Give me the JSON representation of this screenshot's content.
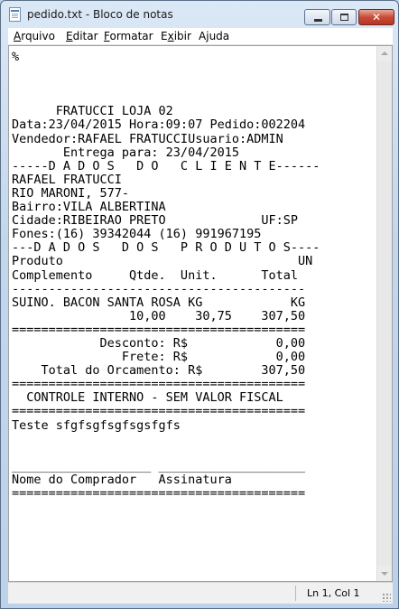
{
  "window": {
    "title": "pedido.txt - Bloco de notas"
  },
  "menu": {
    "items": [
      {
        "label": "Arquivo",
        "mnemonic": "A",
        "rest": "rquivo"
      },
      {
        "label": "Editar",
        "mnemonic": "E",
        "rest": "ditar"
      },
      {
        "label": "Formatar",
        "mnemonic": "F",
        "rest": "ormatar"
      },
      {
        "label": "Exibir",
        "mnemonic": "x",
        "pre": "E",
        "rest": "ibir"
      },
      {
        "label": "Ajuda",
        "mnemonic": "j",
        "pre": "A",
        "rest": "uda"
      }
    ]
  },
  "document": {
    "text": "%\n\n\n\n      FRATUCCI LOJA 02\nData:23/04/2015 Hora:09:07 Pedido:002204\nVendedor:RAFAEL FRATUCCIUsuario:ADMIN\n       Entrega para: 23/04/2015\n-----D A D O S   D O   C L I E N T E------\nRAFAEL FRATUCCI\nRIO MARONI, 577-\nBairro:VILA ALBERTINA\nCidade:RIBEIRAO PRETO             UF:SP\nFones:(16) 39342044 (16) 991967195\n---D A D O S   D O S   P R O D U T O S----\nProduto                                UN\nComplemento     Qtde.  Unit.      Total\n----------------------------------------\nSUINO. BACON SANTA ROSA KG            KG\n                10,00    30,75    307,50\n========================================\n            Desconto: R$            0,00\n               Frete: R$            0,00\n    Total do Orcamento: R$        307,50\n========================================\n  CONTROLE INTERNO - SEM VALOR FISCAL\n========================================\nTeste sfgfsgfsgfsgsfgfs\n\n\n___________________ ____________________\nNome do Comprador   Assinatura\n========================================"
  },
  "status": {
    "position": "Ln 1, Col 1"
  }
}
